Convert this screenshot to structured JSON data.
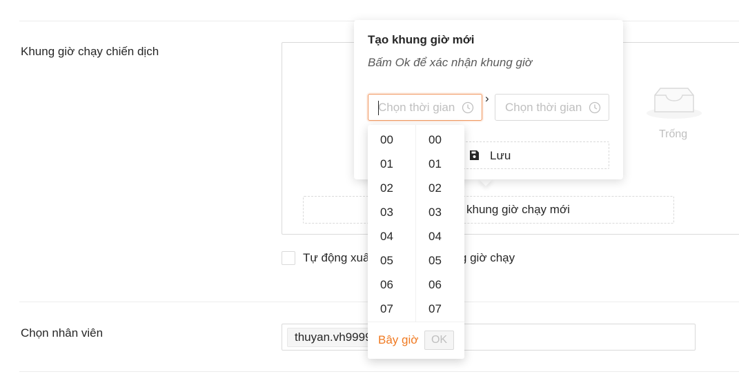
{
  "form": {
    "schedule_label": "Khung giờ chạy chiến dịch",
    "empty_text": "Trống",
    "add_slot_label": "khung giờ chạy mới",
    "auto_export_label_start": "Tự động xuấ",
    "auto_export_label_end": "ng giờ chạy",
    "employee_label": "Chọn nhân viên",
    "employee_tag": "thuyan.vh9999"
  },
  "popover": {
    "title": "Tạo khung giờ mới",
    "subtitle": "Bấm Ok để xác nhận khung giờ",
    "start_placeholder": "Chọn thời gian",
    "end_placeholder": "Chọn thời gian",
    "separator": "›",
    "save_label": "Lưu"
  },
  "picker": {
    "hours": [
      "00",
      "01",
      "02",
      "03",
      "04",
      "05",
      "06",
      "07"
    ],
    "minutes": [
      "00",
      "01",
      "02",
      "03",
      "04",
      "05",
      "06",
      "07"
    ],
    "now_label": "Bây giờ",
    "ok_label": "OK"
  },
  "colors": {
    "accent": "#f07a22",
    "focus_border": "#f0955c",
    "border": "#d9d9d9",
    "placeholder": "#bfbfbf"
  },
  "icons": [
    "clock-icon",
    "save-icon",
    "empty-inbox-icon",
    "chevron-right-icon"
  ]
}
